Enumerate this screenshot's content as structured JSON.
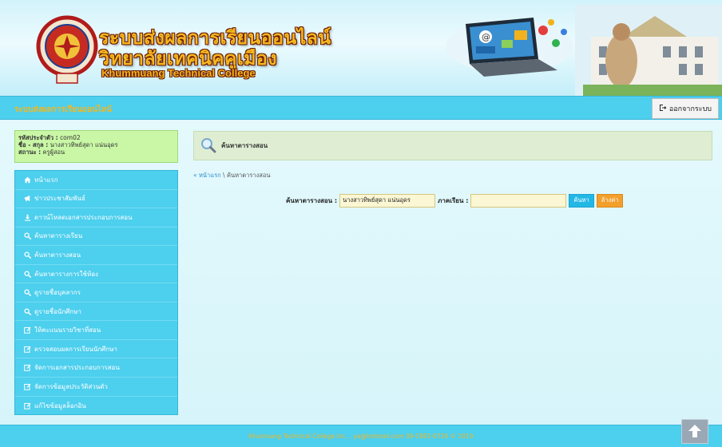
{
  "header": {
    "title_th_1": "ระบบส่งผลการเรียนออนไลน์",
    "title_th_2": "วิทยาลัยเทคนิคคูเมือง",
    "title_en": "Khummuang Technical College",
    "accent_color": "#f3b71e"
  },
  "navbar": {
    "brand": "ระบบส่งผลการเรียนออนไลน์",
    "logout_label": "ออกจากระบบ",
    "logout_icon": "sign-out-icon"
  },
  "user": {
    "id_label": "รหัสประจำตัว :",
    "id_value": "com02",
    "name_label": "ชื่อ - สกุล :",
    "name_value": "นางสาวทิพย์สุดา แน่นอุดร",
    "status_label": "สถานะ :",
    "status_value": "ครูผู้สอน"
  },
  "sidebar": {
    "items": [
      {
        "label": "หน้าแรก",
        "icon": "home-icon"
      },
      {
        "label": "ข่าวประชาสัมพันธ์",
        "icon": "megaphone-icon"
      },
      {
        "label": "ดาวน์โหลดเอกสารประกอบการสอน",
        "icon": "download-icon"
      },
      {
        "label": "ค้นหาตารางเรียน",
        "icon": "search-icon"
      },
      {
        "label": "ค้นหาตารางสอน",
        "icon": "search-icon"
      },
      {
        "label": "ค้นหาตารางการใช้ห้อง",
        "icon": "search-icon"
      },
      {
        "label": "ดูรายชื่อบุคลากร",
        "icon": "search-icon"
      },
      {
        "label": "ดูรายชื่อนักศึกษา",
        "icon": "search-icon"
      },
      {
        "label": "ให้คะแนนรายวิชาที่สอน",
        "icon": "edit-icon"
      },
      {
        "label": "ตรวจสอบผลการเรียนนักศึกษา",
        "icon": "edit-icon"
      },
      {
        "label": "จัดการเอกสารประกอบการสอน",
        "icon": "edit-icon"
      },
      {
        "label": "จัดการข้อมูลประวัติส่วนตัว",
        "icon": "edit-icon"
      },
      {
        "label": "แก้ไขข้อมูลล็อกอิน",
        "icon": "edit-icon"
      }
    ]
  },
  "main": {
    "page_title": "ค้นหาตารางสอน",
    "breadcrumb_home": "« หน้าแรก",
    "breadcrumb_sep": " \\ ",
    "breadcrumb_current": "ค้นหาตารางสอน",
    "search": {
      "teacher_label": "ค้นหาตารางสอน :",
      "teacher_value": "นางสาวทิพย์สุดา แน่นอุดร",
      "term_label": "ภาคเรียน :",
      "term_value": "",
      "search_button": "ค้นหา",
      "clear_button": "ล้างค่า"
    }
  },
  "footer": {
    "text": "Khumuang Technical College  Inc. , ya@hotmail.com 09-1892-0729 © 2019",
    "to_top_icon": "arrow-up-icon"
  }
}
